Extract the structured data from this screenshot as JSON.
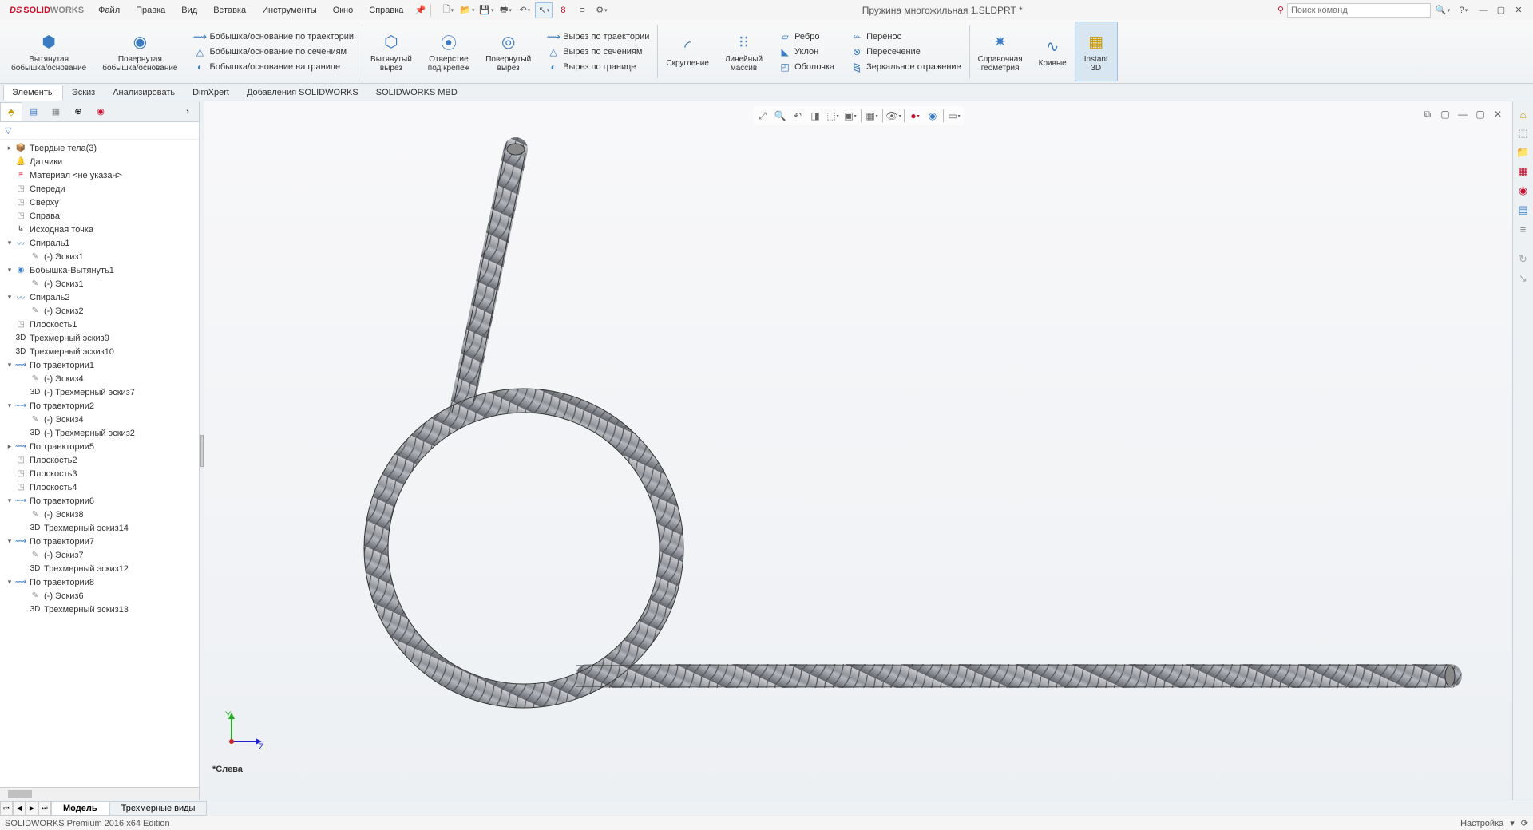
{
  "app": {
    "brand_ds": "DS",
    "brand_solid": "SOLID",
    "brand_works": "WORKS",
    "title": "Пружина многожильная 1.SLDPRT *"
  },
  "menu": [
    "Файл",
    "Правка",
    "Вид",
    "Вставка",
    "Инструменты",
    "Окно",
    "Справка"
  ],
  "search_placeholder": "Поиск команд",
  "ribbon": {
    "g1": {
      "label": "Вытянутая\nбобышка/основание"
    },
    "g2": {
      "label": "Повернутая\nбобышка/основание"
    },
    "g3": [
      "Бобышка/основание по траектории",
      "Бобышка/основание по сечениям",
      "Бобышка/основание на границе"
    ],
    "g4": {
      "label": "Вытянутый\nвырез"
    },
    "g5": {
      "label": "Отверстие\nпод крепеж"
    },
    "g6": {
      "label": "Повернутый\nвырез"
    },
    "g7": [
      "Вырез по траектории",
      "Вырез по сечениям",
      "Вырез по границе"
    ],
    "g8": {
      "label": "Скругление"
    },
    "g9": {
      "label": "Линейный\nмассив"
    },
    "g10": [
      "Ребро",
      "Уклон",
      "Оболочка"
    ],
    "g11": [
      "Перенос",
      "Пересечение",
      "Зеркальное отражение"
    ],
    "g12": {
      "label": "Справочная\nгеометрия"
    },
    "g13": {
      "label": "Кривые"
    },
    "g14": {
      "label": "Instant\n3D"
    }
  },
  "tabs": [
    "Элементы",
    "Эскиз",
    "Анализировать",
    "DimXpert",
    "Добавления SOLIDWORKS",
    "SOLIDWORKS MBD"
  ],
  "active_tab": 0,
  "tree": [
    {
      "d": 0,
      "t": "▸",
      "i": "📦",
      "c": "#c90",
      "l": "Твердые тела(3)"
    },
    {
      "d": 0,
      "t": "",
      "i": "🔔",
      "c": "#888",
      "l": "Датчики"
    },
    {
      "d": 0,
      "t": "",
      "i": "≡",
      "c": "#c8102e",
      "l": "Материал <не указан>"
    },
    {
      "d": 0,
      "t": "",
      "i": "◳",
      "c": "#888",
      "l": "Спереди"
    },
    {
      "d": 0,
      "t": "",
      "i": "◳",
      "c": "#888",
      "l": "Сверху"
    },
    {
      "d": 0,
      "t": "",
      "i": "◳",
      "c": "#888",
      "l": "Справа"
    },
    {
      "d": 0,
      "t": "",
      "i": "↳",
      "c": "#333",
      "l": "Исходная точка"
    },
    {
      "d": 0,
      "t": "▾",
      "i": "〰",
      "c": "#3b7bc1",
      "l": "Спираль1"
    },
    {
      "d": 1,
      "t": "",
      "i": "✎",
      "c": "#888",
      "l": "(-) Эскиз1"
    },
    {
      "d": 0,
      "t": "▾",
      "i": "◉",
      "c": "#3b7bc1",
      "l": "Бобышка-Вытянуть1"
    },
    {
      "d": 1,
      "t": "",
      "i": "✎",
      "c": "#888",
      "l": "(-) Эскиз1"
    },
    {
      "d": 0,
      "t": "▾",
      "i": "〰",
      "c": "#3b7bc1",
      "l": "Спираль2"
    },
    {
      "d": 1,
      "t": "",
      "i": "✎",
      "c": "#888",
      "l": "(-) Эскиз2"
    },
    {
      "d": 0,
      "t": "",
      "i": "◳",
      "c": "#888",
      "l": "Плоскость1"
    },
    {
      "d": 0,
      "t": "",
      "i": "3D",
      "c": "#333",
      "l": "Трехмерный эскиз9"
    },
    {
      "d": 0,
      "t": "",
      "i": "3D",
      "c": "#333",
      "l": "Трехмерный эскиз10"
    },
    {
      "d": 0,
      "t": "▾",
      "i": "⟿",
      "c": "#3b7bc1",
      "l": "По траектории1"
    },
    {
      "d": 1,
      "t": "",
      "i": "✎",
      "c": "#888",
      "l": "(-) Эскиз4"
    },
    {
      "d": 1,
      "t": "",
      "i": "3D",
      "c": "#333",
      "l": "(-) Трехмерный эскиз7"
    },
    {
      "d": 0,
      "t": "▾",
      "i": "⟿",
      "c": "#3b7bc1",
      "l": "По траектории2"
    },
    {
      "d": 1,
      "t": "",
      "i": "✎",
      "c": "#888",
      "l": "(-) Эскиз4"
    },
    {
      "d": 1,
      "t": "",
      "i": "3D",
      "c": "#333",
      "l": "(-) Трехмерный эскиз2"
    },
    {
      "d": 0,
      "t": "▸",
      "i": "⟿",
      "c": "#3b7bc1",
      "l": "По траектории5"
    },
    {
      "d": 0,
      "t": "",
      "i": "◳",
      "c": "#888",
      "l": "Плоскость2"
    },
    {
      "d": 0,
      "t": "",
      "i": "◳",
      "c": "#888",
      "l": "Плоскость3"
    },
    {
      "d": 0,
      "t": "",
      "i": "◳",
      "c": "#888",
      "l": "Плоскость4"
    },
    {
      "d": 0,
      "t": "▾",
      "i": "⟿",
      "c": "#3b7bc1",
      "l": "По траектории6"
    },
    {
      "d": 1,
      "t": "",
      "i": "✎",
      "c": "#888",
      "l": "(-) Эскиз8"
    },
    {
      "d": 1,
      "t": "",
      "i": "3D",
      "c": "#333",
      "l": "Трехмерный эскиз14"
    },
    {
      "d": 0,
      "t": "▾",
      "i": "⟿",
      "c": "#3b7bc1",
      "l": "По траектории7"
    },
    {
      "d": 1,
      "t": "",
      "i": "✎",
      "c": "#888",
      "l": "(-) Эскиз7"
    },
    {
      "d": 1,
      "t": "",
      "i": "3D",
      "c": "#333",
      "l": "Трехмерный эскиз12"
    },
    {
      "d": 0,
      "t": "▾",
      "i": "⟿",
      "c": "#3b7bc1",
      "l": "По траектории8"
    },
    {
      "d": 1,
      "t": "",
      "i": "✎",
      "c": "#888",
      "l": "(-) Эскиз6"
    },
    {
      "d": 1,
      "t": "",
      "i": "3D",
      "c": "#333",
      "l": "Трехмерный эскиз13"
    }
  ],
  "orientation": "*Слева",
  "bottom_tabs": [
    "Модель",
    "Трехмерные виды"
  ],
  "status_left": "SOLIDWORKS Premium 2016 x64 Edition",
  "status_right": "Настройка"
}
